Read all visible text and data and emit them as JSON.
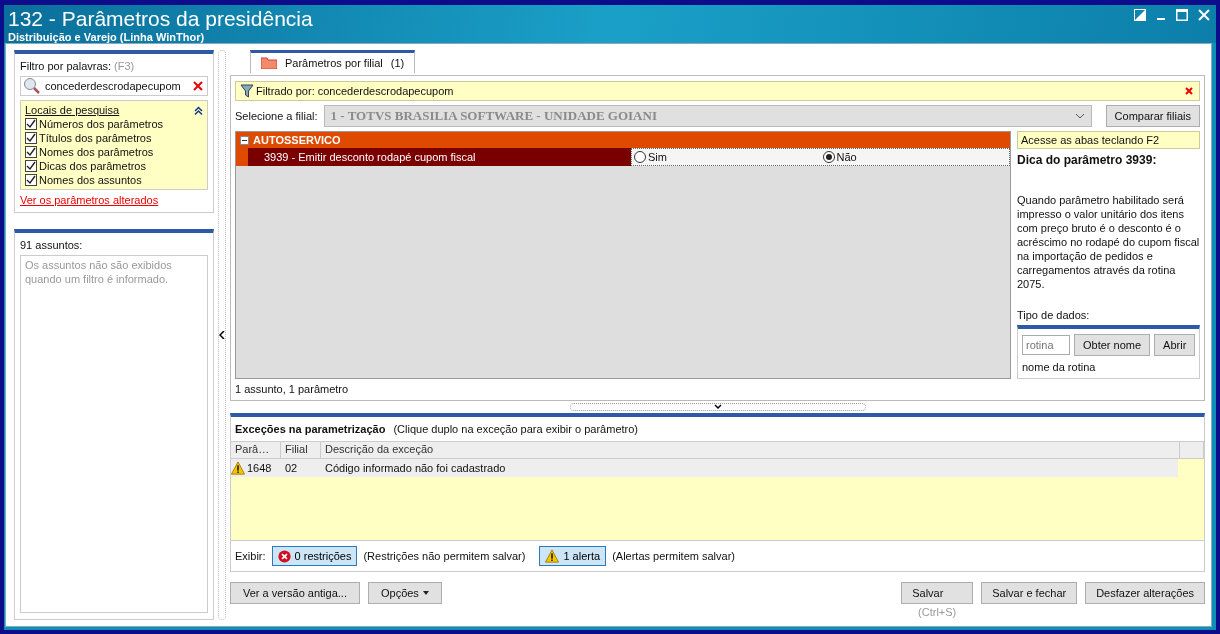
{
  "window": {
    "title": "132 - Parâmetros da presidência",
    "subtitle": "Distribuição e Varejo (Linha WinThor)"
  },
  "filter": {
    "label": "Filtro por palavras:",
    "shortcut": "(F3)",
    "value": "concederdescrodapecupom",
    "locations_title": "Locais de pesquisa",
    "locations_expanded": true,
    "locations": [
      {
        "label": "Números dos parâmetros",
        "checked": true
      },
      {
        "label": "Títulos dos parâmetros",
        "checked": true
      },
      {
        "label": "Nomes dos parâmetros",
        "checked": true
      },
      {
        "label": "Dicas dos parâmetros",
        "checked": true
      },
      {
        "label": "Nomes dos assuntos",
        "checked": true
      }
    ],
    "link": "Ver os parâmetros alterados"
  },
  "subjects": {
    "label": "91 assuntos:",
    "message": "Os assuntos não são exibidos quando um filtro é informado."
  },
  "tabs": [
    {
      "label": "Parâmetros por filial",
      "count": "(1)",
      "selected": true
    }
  ],
  "filter_bar": {
    "text": "Filtrado por: concederdescrodapecupom"
  },
  "branch": {
    "label": "Selecione a filial:",
    "value": "1 - TOTVS BRASILIA SOFTWARE - UNIDADE GOIANI",
    "disabled": true,
    "compare_button": "Comparar filiais"
  },
  "groups": [
    {
      "name": "AUTOSSERVICO",
      "expanded": true,
      "params": [
        {
          "label": "3939 - Emitir desconto rodapé cupom fiscal",
          "selected": true,
          "options": [
            {
              "label": "Sim",
              "selected": false
            },
            {
              "label": "Não",
              "selected": true
            }
          ]
        }
      ]
    }
  ],
  "summary": "1 assunto, 1 parâmetro",
  "hint": {
    "note": "Acesse as abas teclando F2",
    "title": "Dica do parâmetro 3939:",
    "text": "Quando parâmetro habilitado será impresso o valor unitário dos itens com preço bruto é o desconto é o acréscimo no rodapé do cupom fiscal na importação de pedidos e carregamentos através da rotina 2075.",
    "data_type_label": "Tipo de dados:"
  },
  "routine": {
    "placeholder": "rotina",
    "buttons": [
      "Obter nome",
      "Abrir"
    ],
    "name": "nome da rotina"
  },
  "exceptions": {
    "title": "Exceções na parametrização",
    "hint": "(Clique duplo na exceção para exibir o parâmetro)",
    "columns": [
      "Parâ…",
      "Filial",
      "Descrição da exceção"
    ],
    "rows": [
      {
        "kind": "alert",
        "cells": [
          "1648",
          "02",
          "Código informado não foi cadastrado"
        ]
      }
    ],
    "show_label": "Exibir:",
    "toggles": [
      {
        "kind": "error",
        "label": "0 restrições",
        "note": "(Restrições não permitem salvar)",
        "on": true
      },
      {
        "kind": "alert",
        "label": "1 alerta",
        "note": "(Alertas permitem salvar)",
        "on": true
      }
    ]
  },
  "footer": {
    "left": [
      {
        "kind": "plain",
        "label": "Ver a versão antiga..."
      },
      {
        "kind": "menu",
        "label": "Opções"
      }
    ],
    "right": [
      {
        "label": "Salvar",
        "note": "(Ctrl+S)"
      },
      {
        "label": "Salvar e fechar"
      },
      {
        "label": "Desfazer alterações"
      }
    ]
  }
}
